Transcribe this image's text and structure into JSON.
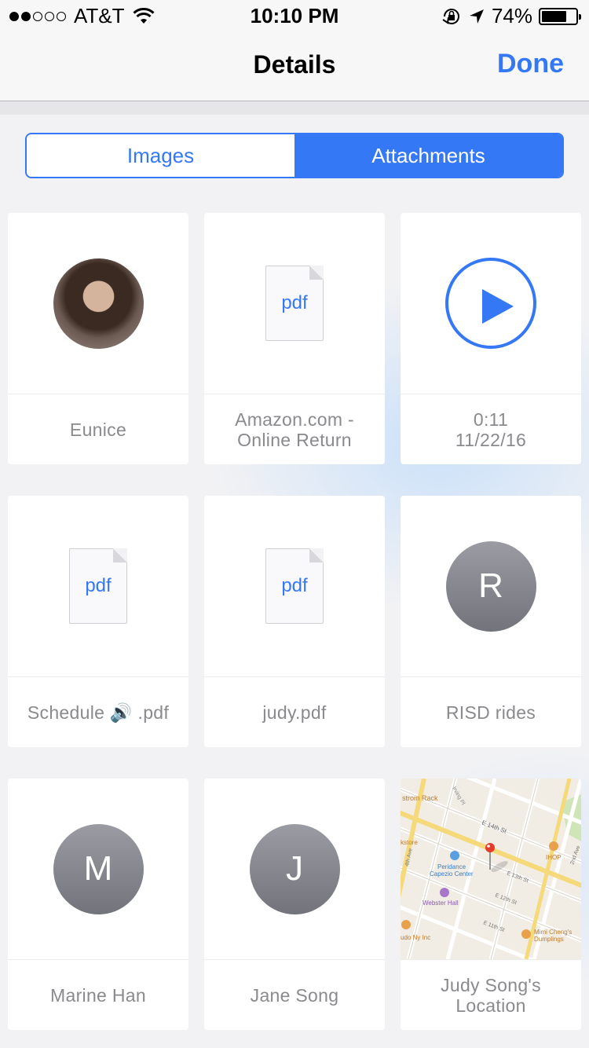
{
  "status_bar": {
    "carrier": "AT&T",
    "time": "10:10 PM",
    "battery": "74%",
    "battery_level": 0.74,
    "signal_bars_filled": 2,
    "signal_bars_total": 5,
    "icons": [
      "wifi-icon",
      "orientation-lock-icon",
      "location-arrow-icon",
      "battery-icon"
    ]
  },
  "nav": {
    "title": "Details",
    "done_label": "Done"
  },
  "segments": {
    "images_label": "Images",
    "attachments_label": "Attachments",
    "selected": "Attachments"
  },
  "items": [
    {
      "type": "photo-avatar",
      "caption_lines": [
        "Eunice"
      ]
    },
    {
      "type": "pdf",
      "ext": "pdf",
      "caption_lines": [
        "Amazon.com -",
        "Online Return"
      ]
    },
    {
      "type": "audio",
      "caption_lines": [
        "0:11",
        "11/22/16"
      ]
    },
    {
      "type": "pdf",
      "ext": "pdf",
      "caption_lines": [
        "Schedule 🔊 .pdf"
      ]
    },
    {
      "type": "pdf",
      "ext": "pdf",
      "caption_lines": [
        "judy.pdf"
      ]
    },
    {
      "type": "contact",
      "initial": "R",
      "caption_lines": [
        "RISD rides"
      ]
    },
    {
      "type": "contact",
      "initial": "M",
      "caption_lines": [
        "Marine Han"
      ]
    },
    {
      "type": "contact",
      "initial": "J",
      "caption_lines": [
        "Jane Song"
      ]
    },
    {
      "type": "map",
      "caption_lines": [
        "Judy Song's",
        "Location"
      ]
    }
  ],
  "map_labels": {
    "strom_rack": "strom Rack",
    "irving_pl": "Irving Pl",
    "e14": "E 14th St",
    "kstore": "kstore",
    "ihop": "IHOP",
    "ave4": "4th Ave",
    "ave2": "2nd Ave",
    "peridance1": "Peridance",
    "peridance2": "Capezio Center",
    "e13": "E 13th St",
    "e12": "E 12th St",
    "webster": "Webster Hall",
    "e11": "E 11th St",
    "nyinc": "udo Ny Inc",
    "mimi1": "Mimi Cheng's",
    "mimi2": "Dumplings"
  },
  "colors": {
    "accent": "#3478f6",
    "caption": "#8a8a8e",
    "background": "#f2f2f4"
  }
}
